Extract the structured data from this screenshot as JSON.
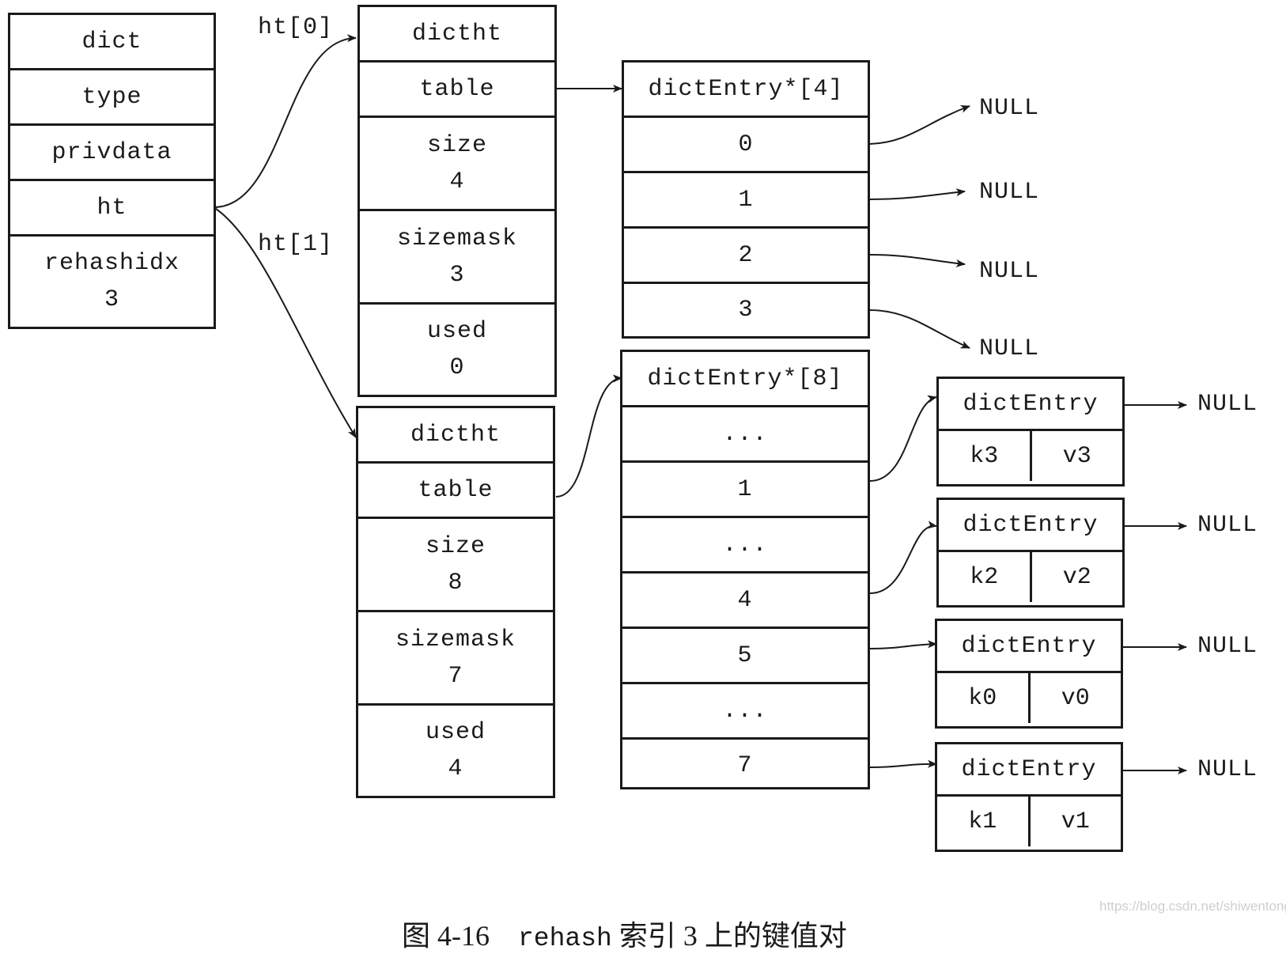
{
  "dict": {
    "title": "dict",
    "fields": [
      "type",
      "privdata",
      "ht"
    ],
    "rehashidx_label": "rehashidx",
    "rehashidx_value": "3"
  },
  "labels": {
    "ht0": "ht[0]",
    "ht1": "ht[1]"
  },
  "ht0": {
    "title": "dictht",
    "table": "table",
    "size_label": "size",
    "size": "4",
    "sizemask_label": "sizemask",
    "sizemask": "3",
    "used_label": "used",
    "used": "0"
  },
  "ht1": {
    "title": "dictht",
    "table": "table",
    "size_label": "size",
    "size": "8",
    "sizemask_label": "sizemask",
    "sizemask": "7",
    "used_label": "used",
    "used": "4"
  },
  "table4": {
    "title": "dictEntry*[4]",
    "slots": [
      "0",
      "1",
      "2",
      "3"
    ]
  },
  "table8": {
    "title": "dictEntry*[8]",
    "slots": [
      "...",
      "1",
      "...",
      "4",
      "5",
      "...",
      "7"
    ]
  },
  "null_label": "NULL",
  "entries": [
    {
      "title": "dictEntry",
      "key": "k3",
      "value": "v3"
    },
    {
      "title": "dictEntry",
      "key": "k2",
      "value": "v2"
    },
    {
      "title": "dictEntry",
      "key": "k0",
      "value": "v0"
    },
    {
      "title": "dictEntry",
      "key": "k1",
      "value": "v1"
    }
  ],
  "caption": {
    "figure": "图 4-16",
    "code": "rehash",
    "text": "索引 3 上的键值对"
  },
  "watermark": "https://blog.csdn.net/shiwentong"
}
